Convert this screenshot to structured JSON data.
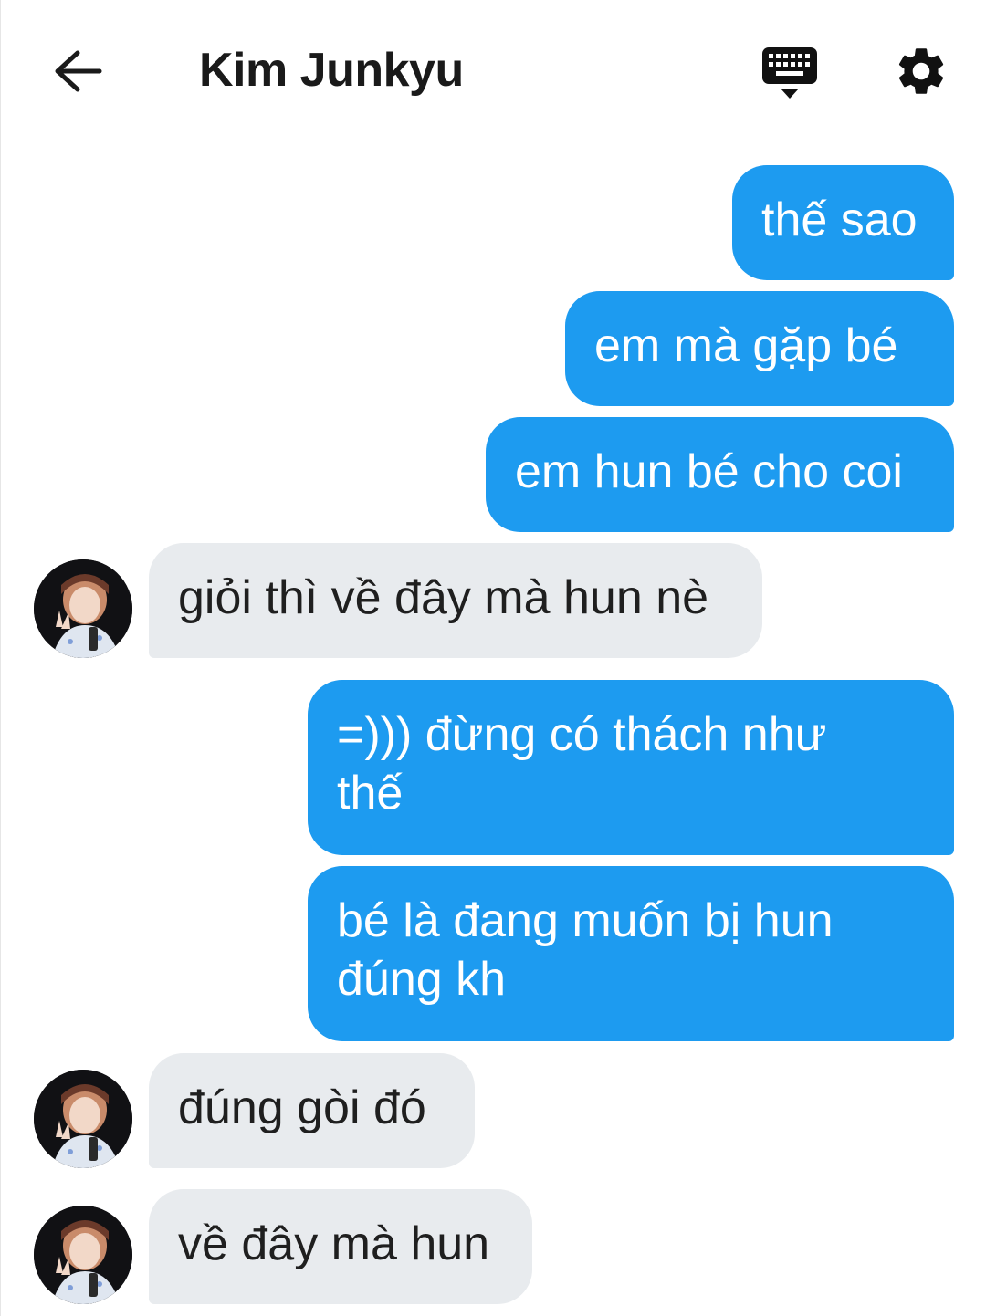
{
  "header": {
    "title": "Kim Junkyu",
    "back_icon": "arrow-left-icon",
    "keyboard_icon": "keyboard-icon",
    "settings_icon": "gear-icon"
  },
  "colors": {
    "sent_bubble": "#1d9bf0",
    "received_bubble": "#e8ebee",
    "background": "#ffffff"
  },
  "messages": [
    {
      "direction": "sent",
      "text": "thế sao"
    },
    {
      "direction": "sent",
      "text": "em mà gặp bé"
    },
    {
      "direction": "sent",
      "text": "em hun bé cho coi"
    },
    {
      "direction": "received",
      "text": "giỏi thì về đây mà hun nè"
    },
    {
      "direction": "sent",
      "text": "=))) đừng có thách như thế"
    },
    {
      "direction": "sent",
      "text": "bé là đang muốn bị hun đúng kh"
    },
    {
      "direction": "received",
      "text": "đúng gòi đó"
    },
    {
      "direction": "received",
      "text": "về đây mà hun"
    }
  ]
}
